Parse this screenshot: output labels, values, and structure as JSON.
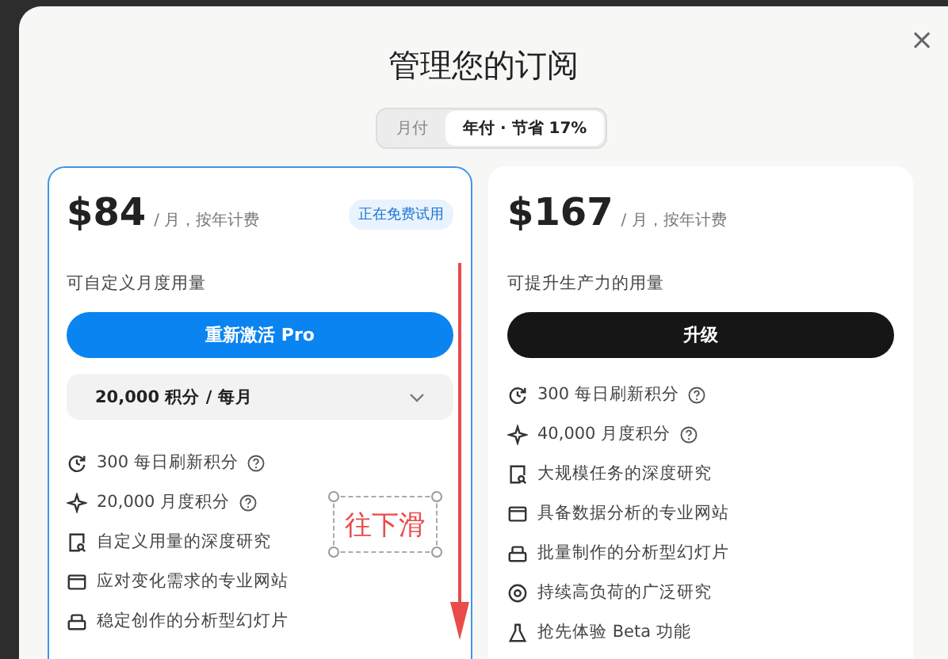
{
  "dialog": {
    "title": "管理您的订阅",
    "close": "×"
  },
  "billing_tabs": [
    {
      "label": "月付",
      "selected": false
    },
    {
      "label": "年付 · 节省 17%",
      "selected": true
    }
  ],
  "plans": [
    {
      "price": "$84",
      "period": "/ 月，按年计费",
      "badge": "正在免费试用",
      "selected": true,
      "description": "可自定义月度用量",
      "button": {
        "label": "重新激活 Pro",
        "kind": "primary"
      },
      "credits_select": "20,000 积分 / 每月",
      "features": [
        {
          "kind": "refresh",
          "text": "300 每日刷新积分",
          "help": true
        },
        {
          "kind": "sparkle",
          "text": "20,000 月度积分",
          "help": true
        },
        {
          "kind": "research",
          "text": "自定义用量的深度研究",
          "help": false
        },
        {
          "kind": "website",
          "text": "应对变化需求的专业网站",
          "help": false
        },
        {
          "kind": "slides",
          "text": "稳定创作的分析型幻灯片",
          "help": false
        }
      ]
    },
    {
      "price": "$167",
      "period": "/ 月，按年计费",
      "selected": false,
      "description": "可提升生产力的用量",
      "button": {
        "label": "升级",
        "kind": "dark"
      },
      "features": [
        {
          "kind": "refresh",
          "text": "300 每日刷新积分",
          "help": true
        },
        {
          "kind": "sparkle",
          "text": "40,000 月度积分",
          "help": true
        },
        {
          "kind": "research",
          "text": "大规模任务的深度研究",
          "help": false
        },
        {
          "kind": "website",
          "text": "具备数据分析的专业网站",
          "help": false
        },
        {
          "kind": "slides",
          "text": "批量制作的分析型幻灯片",
          "help": false
        },
        {
          "kind": "wide",
          "text": "持续高负荷的广泛研究",
          "help": false
        },
        {
          "kind": "beta",
          "text": "抢先体验 Beta 功能",
          "help": false
        }
      ]
    }
  ],
  "annotation": {
    "text": "往下滑"
  }
}
